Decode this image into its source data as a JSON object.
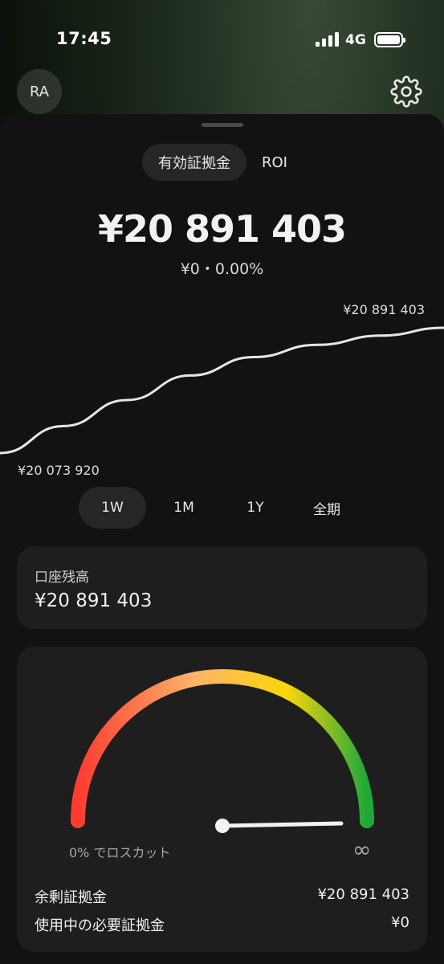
{
  "status": {
    "time": "17:45",
    "network": "4G"
  },
  "header": {
    "avatar_initials": "RA",
    "settings_icon": "gear-icon"
  },
  "tabs": [
    {
      "label": "有効証拠金",
      "active": true
    },
    {
      "label": "ROI",
      "active": false
    }
  ],
  "summary": {
    "value": "¥20 891 403",
    "change": "¥0・0.00%"
  },
  "chart_data": {
    "type": "line",
    "series": [
      {
        "values": [
          20073920,
          20250000,
          20420000,
          20580000,
          20700000,
          20780000,
          20840000,
          20891403
        ]
      }
    ],
    "max_label": "¥20 891 403",
    "min_label": "¥20 073 920",
    "line_color": "#e6e6e6"
  },
  "ranges": [
    {
      "label": "1W",
      "active": true
    },
    {
      "label": "1M",
      "active": false
    },
    {
      "label": "1Y",
      "active": false
    },
    {
      "label": "全期",
      "active": false
    }
  ],
  "balance": {
    "label": "口座残高",
    "value": "¥20 891 403"
  },
  "gauge": {
    "left_label": "0% でロスカット",
    "right_label": "∞",
    "level": 1.0,
    "colors": [
      "#ff3b30",
      "#ffb36b",
      "#ffd60a",
      "#1fa83a"
    ]
  },
  "margin": [
    {
      "label": "余剰証拠金",
      "value": "¥20 891 403"
    },
    {
      "label": "使用中の必要証拠金",
      "value": "¥0"
    }
  ]
}
